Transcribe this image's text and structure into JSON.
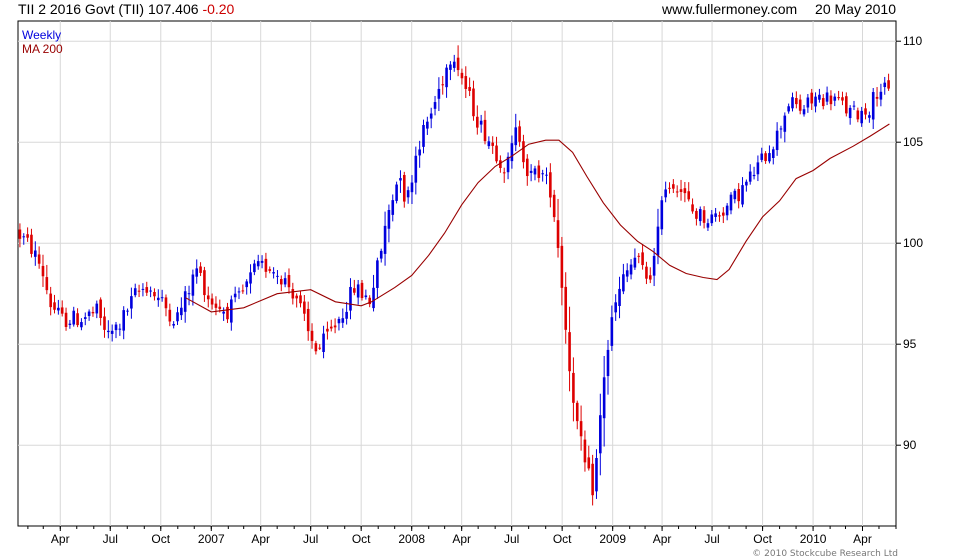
{
  "header": {
    "symbol": "TII 2 2016 Govt (TII)",
    "last": "107.406",
    "change": "-0.20",
    "site": "www.fullermoney.com",
    "date": "20 May 2010"
  },
  "footer": {
    "copyright": "© 2010 Stockcube Research Ltd"
  },
  "colors": {
    "up": "#0000dd",
    "down": "#dd0000",
    "ma": "#990000",
    "grid": "#d8d8d8",
    "axis": "#000000"
  },
  "chart_data": {
    "type": "candlestick",
    "frequency": "Weekly",
    "legend": [
      "Weekly",
      "MA 200"
    ],
    "legend_placement": "top-left",
    "y_axis_side": "right",
    "ylim": [
      86,
      111
    ],
    "y_ticks": [
      90,
      95,
      100,
      105,
      110
    ],
    "x_range": [
      "2006-01-14",
      "2010-06-01"
    ],
    "x_ticks": [
      {
        "label": "Apr",
        "date": "2006-04-01"
      },
      {
        "label": "Jul",
        "date": "2006-07-01"
      },
      {
        "label": "Oct",
        "date": "2006-10-01"
      },
      {
        "label": "2007",
        "date": "2007-01-01"
      },
      {
        "label": "Apr",
        "date": "2007-04-01"
      },
      {
        "label": "Jul",
        "date": "2007-07-01"
      },
      {
        "label": "Oct",
        "date": "2007-10-01"
      },
      {
        "label": "2008",
        "date": "2008-01-01"
      },
      {
        "label": "Apr",
        "date": "2008-04-01"
      },
      {
        "label": "Jul",
        "date": "2008-07-01"
      },
      {
        "label": "Oct",
        "date": "2008-10-01"
      },
      {
        "label": "2009",
        "date": "2009-01-01"
      },
      {
        "label": "Apr",
        "date": "2009-04-01"
      },
      {
        "label": "Jul",
        "date": "2009-07-01"
      },
      {
        "label": "Oct",
        "date": "2009-10-01"
      },
      {
        "label": "2010",
        "date": "2010-01-01"
      },
      {
        "label": "Apr",
        "date": "2010-04-01"
      }
    ],
    "grid": true,
    "price_path": [
      [
        "2006-01-14",
        100.6
      ],
      [
        "2006-02-10",
        99.8
      ],
      [
        "2006-03-01",
        98.8
      ],
      [
        "2006-03-18",
        97.0
      ],
      [
        "2006-04-08",
        96.2
      ],
      [
        "2006-05-15",
        96.3
      ],
      [
        "2006-06-10",
        96.6
      ],
      [
        "2006-07-01",
        95.4
      ],
      [
        "2006-07-22",
        96.0
      ],
      [
        "2006-08-20",
        97.5
      ],
      [
        "2006-09-10",
        97.9
      ],
      [
        "2006-10-05",
        97.1
      ],
      [
        "2006-11-01",
        96.2
      ],
      [
        "2006-11-20",
        97.4
      ],
      [
        "2006-12-10",
        98.8
      ],
      [
        "2007-01-01",
        97.2
      ],
      [
        "2007-02-01",
        96.6
      ],
      [
        "2007-03-01",
        97.4
      ],
      [
        "2007-03-25",
        98.7
      ],
      [
        "2007-04-20",
        98.9
      ],
      [
        "2007-05-15",
        98.3
      ],
      [
        "2007-06-10",
        97.3
      ],
      [
        "2007-07-01",
        95.4
      ],
      [
        "2007-07-18",
        94.7
      ],
      [
        "2007-08-10",
        95.6
      ],
      [
        "2007-09-01",
        96.6
      ],
      [
        "2007-09-22",
        97.8
      ],
      [
        "2007-10-20",
        97.2
      ],
      [
        "2007-11-05",
        99.0
      ],
      [
        "2007-11-25",
        101.8
      ],
      [
        "2007-12-15",
        103.6
      ],
      [
        "2007-12-25",
        101.8
      ],
      [
        "2008-01-15",
        104.8
      ],
      [
        "2008-02-10",
        106.5
      ],
      [
        "2008-03-05",
        108.5
      ],
      [
        "2008-03-20",
        109.6
      ],
      [
        "2008-04-10",
        107.8
      ],
      [
        "2008-05-05",
        106.0
      ],
      [
        "2008-06-01",
        104.8
      ],
      [
        "2008-06-25",
        103.6
      ],
      [
        "2008-07-15",
        105.8
      ],
      [
        "2008-08-05",
        103.2
      ],
      [
        "2008-08-25",
        103.6
      ],
      [
        "2008-09-15",
        102.6
      ],
      [
        "2008-10-01",
        99.0
      ],
      [
        "2008-10-15",
        94.5
      ],
      [
        "2008-11-01",
        91.0
      ],
      [
        "2008-11-15",
        89.0
      ],
      [
        "2008-12-01",
        87.7
      ],
      [
        "2008-12-20",
        93.5
      ],
      [
        "2009-01-05",
        96.5
      ],
      [
        "2009-01-25",
        98.3
      ],
      [
        "2009-02-15",
        99.3
      ],
      [
        "2009-03-10",
        98.2
      ],
      [
        "2009-03-25",
        99.5
      ],
      [
        "2009-04-05",
        102.8
      ],
      [
        "2009-05-01",
        103.0
      ],
      [
        "2009-06-01",
        101.5
      ],
      [
        "2009-07-01",
        101.2
      ],
      [
        "2009-08-01",
        101.8
      ],
      [
        "2009-09-01",
        102.8
      ],
      [
        "2009-10-01",
        104.0
      ],
      [
        "2009-11-01",
        105.4
      ],
      [
        "2009-11-20",
        107.0
      ],
      [
        "2009-12-15",
        106.6
      ],
      [
        "2010-01-10",
        107.2
      ],
      [
        "2010-02-10",
        107.2
      ],
      [
        "2010-03-15",
        106.4
      ],
      [
        "2010-04-15",
        106.6
      ],
      [
        "2010-05-05",
        107.8
      ],
      [
        "2010-05-20",
        107.4
      ]
    ],
    "ma200": [
      [
        "2006-11-15",
        97.3
      ],
      [
        "2007-01-01",
        96.6
      ],
      [
        "2007-03-01",
        96.8
      ],
      [
        "2007-05-01",
        97.5
      ],
      [
        "2007-07-01",
        97.7
      ],
      [
        "2007-08-15",
        97.1
      ],
      [
        "2007-10-01",
        96.9
      ],
      [
        "2007-10-20",
        97.1
      ],
      [
        "2007-12-01",
        97.8
      ],
      [
        "2008-01-01",
        98.4
      ],
      [
        "2008-02-01",
        99.4
      ],
      [
        "2008-03-01",
        100.5
      ],
      [
        "2008-04-01",
        101.9
      ],
      [
        "2008-05-01",
        103.0
      ],
      [
        "2008-06-01",
        103.8
      ],
      [
        "2008-07-01",
        104.3
      ],
      [
        "2008-08-01",
        104.9
      ],
      [
        "2008-09-01",
        105.1
      ],
      [
        "2008-09-25",
        105.1
      ],
      [
        "2008-10-20",
        104.5
      ],
      [
        "2008-11-15",
        103.3
      ],
      [
        "2008-12-15",
        102.0
      ],
      [
        "2009-01-15",
        100.9
      ],
      [
        "2009-02-15",
        100.1
      ],
      [
        "2009-03-15",
        99.6
      ],
      [
        "2009-04-15",
        98.9
      ],
      [
        "2009-05-15",
        98.5
      ],
      [
        "2009-06-15",
        98.3
      ],
      [
        "2009-07-10",
        98.2
      ],
      [
        "2009-08-01",
        98.7
      ],
      [
        "2009-09-01",
        100.1
      ],
      [
        "2009-10-01",
        101.3
      ],
      [
        "2009-11-01",
        102.1
      ],
      [
        "2009-12-01",
        103.2
      ],
      [
        "2010-01-01",
        103.6
      ],
      [
        "2010-02-01",
        104.2
      ],
      [
        "2010-03-15",
        104.8
      ],
      [
        "2010-04-15",
        105.3
      ],
      [
        "2010-05-20",
        105.9
      ]
    ]
  }
}
